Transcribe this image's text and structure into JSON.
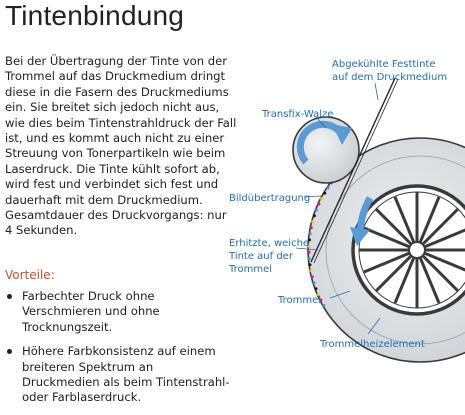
{
  "title": "Tintenbindung",
  "body": "Bei der Übertragung der Tinte von der Trommel auf das Druckmedium dringt diese in die Fasern des Druckmediums ein. Sie breitet sich jedoch nicht aus, wie dies beim Tintenstrahldruck der Fall ist, und es kommt auch nicht zu einer Streuung von Tonerpartikeln wie beim Laserdruck. Die Tinte kühlt sofort ab, wird fest und verbindet sich fest und dauerhaft mit dem Druckmedium. Gesamtdauer des Druckvorgangs: nur 4 Sekunden.",
  "advantages_heading": "Vorteile:",
  "advantages": [
    "Farbechter Druck ohne Verschmieren und ohne Trocknungszeit.",
    "Höhere Farbkonsistenz auf einem breiteren Spektrum an Druckmedien als beim Tintenstrahl- oder Farblaserdruck."
  ],
  "diagram": {
    "labels": {
      "cooled_ink_line1": "Abgekühlte Festtinte",
      "cooled_ink_line2": "auf dem Druckmedium",
      "transfix_roller": "Transfix-Walze",
      "image_transfer": "Bildübertragung",
      "heated_ink_line1": "Erhitzte, weiche",
      "heated_ink_line2": "Tinte auf der",
      "heated_ink_line3": "Trommel",
      "drum": "Trommel",
      "drum_heater": "Trommelheizelement"
    },
    "colors": {
      "label": "#1d6fb3",
      "drum_fill": "#e2e4e6",
      "roller_fill": "#dcdfe2",
      "arrow": "#5b9bd5",
      "ink_dots": [
        "#2a9fd8",
        "#e0148a",
        "#f0d000",
        "#1a1a1a"
      ]
    }
  }
}
